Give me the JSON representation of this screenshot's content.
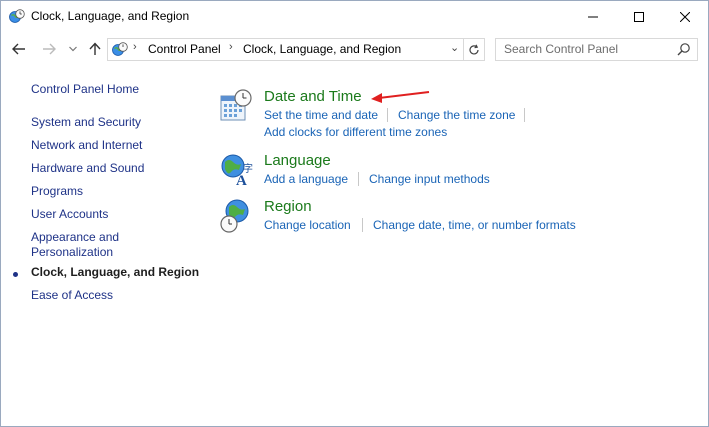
{
  "window": {
    "title": "Clock, Language, and Region",
    "title_icon": "clock-language-region-icon",
    "controls": {
      "minimize": "minimize-icon",
      "maximize": "maximize-icon",
      "close": "close-icon"
    }
  },
  "address_bar": {
    "crumbs": [
      "Control Panel",
      "Clock, Language, and Region"
    ],
    "search_placeholder": "Search Control Panel"
  },
  "left_nav": {
    "home": "Control Panel Home",
    "items": [
      {
        "label": "System and Security"
      },
      {
        "label": "Network and Internet"
      },
      {
        "label": "Hardware and Sound"
      },
      {
        "label": "Programs"
      },
      {
        "label": "User Accounts"
      },
      {
        "label": "Appearance and Personalization"
      },
      {
        "label": "Clock, Language, and Region",
        "current": true
      },
      {
        "label": "Ease of Access"
      }
    ]
  },
  "categories": [
    {
      "title": "Date and Time",
      "icon": "date-and-time-icon",
      "links": [
        "Set the time and date",
        "Change the time zone",
        "Add clocks for different time zones"
      ]
    },
    {
      "title": "Language",
      "icon": "language-icon",
      "links": [
        "Add a language",
        "Change input methods"
      ]
    },
    {
      "title": "Region",
      "icon": "region-icon",
      "links": [
        "Change location",
        "Change date, time, or number formats"
      ]
    }
  ],
  "colors": {
    "category_title": "#1b7a1b",
    "link": "#1a64b6",
    "nav_link": "#1e3287",
    "annotation_arrow": "#e02020"
  }
}
